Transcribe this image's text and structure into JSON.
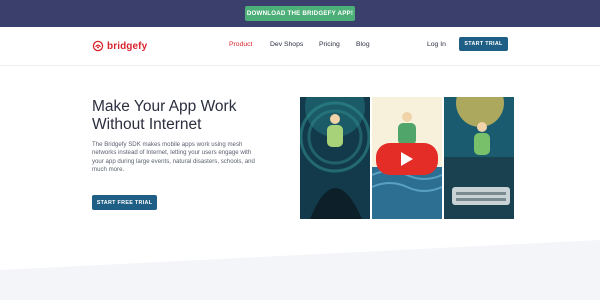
{
  "topbar": {
    "download_label": "DOWNLOAD THE BRIDGEFY APP!"
  },
  "nav": {
    "brand": "bridgefy",
    "links": [
      {
        "label": "Product",
        "active": true
      },
      {
        "label": "Dev Shops",
        "active": false
      },
      {
        "label": "Pricing",
        "active": false
      },
      {
        "label": "Blog",
        "active": false
      }
    ],
    "login_label": "Log In",
    "trial_label": "START TRIAL"
  },
  "hero": {
    "title_line1": "Make Your App Work",
    "title_line2": "Without Internet",
    "body": "The Bridgefy SDK makes mobile apps work using mesh networks instead of Internet, letting your users engage with your app during large events, natural disasters, schools, and much more.",
    "cta_label": "START FREE TRIAL"
  },
  "media": {
    "play_icon": "play-icon"
  },
  "colors": {
    "topbar_bg": "#3a3f6b",
    "download_btn": "#4caf78",
    "brand_red": "#d8262f",
    "primary_btn": "#1f5f86",
    "youtube_red": "#e52d27"
  }
}
